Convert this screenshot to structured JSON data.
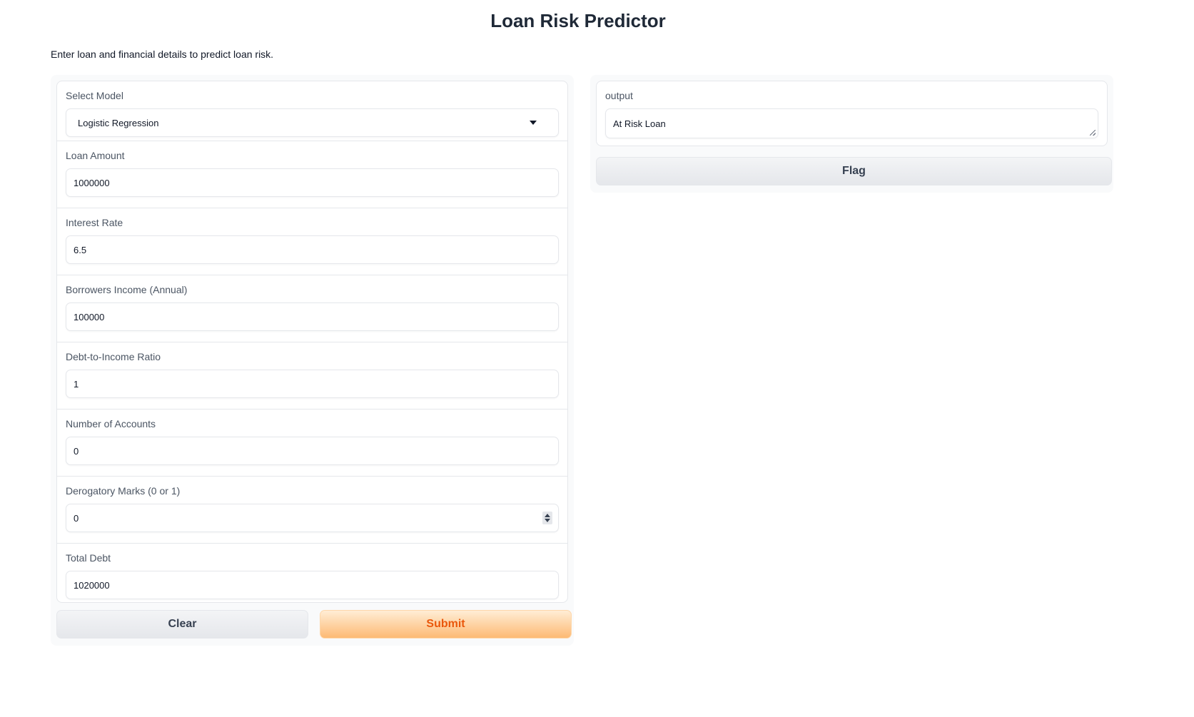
{
  "app": {
    "title": "Loan Risk Predictor",
    "description": "Enter loan and financial details to predict loan risk."
  },
  "form": {
    "model": {
      "label": "Select Model",
      "value": "Logistic Regression"
    },
    "fields": [
      {
        "label": "Loan Amount",
        "value": "1000000"
      },
      {
        "label": "Interest Rate",
        "value": "6.5"
      },
      {
        "label": "Borrowers Income (Annual)",
        "value": "100000"
      },
      {
        "label": "Debt-to-Income Ratio",
        "value": "1"
      },
      {
        "label": "Number of Accounts",
        "value": "0"
      },
      {
        "label": "Derogatory Marks (0 or 1)",
        "value": "0"
      },
      {
        "label": "Total Debt",
        "value": "1020000"
      }
    ],
    "clear_label": "Clear",
    "submit_label": "Submit"
  },
  "output": {
    "label": "output",
    "value": "At Risk Loan",
    "flag_label": "Flag"
  },
  "colors": {
    "accent": "#ea580c",
    "primary_button_start": "#ffedd5",
    "primary_button_end": "#fdba74",
    "border": "#e5e7eb"
  }
}
